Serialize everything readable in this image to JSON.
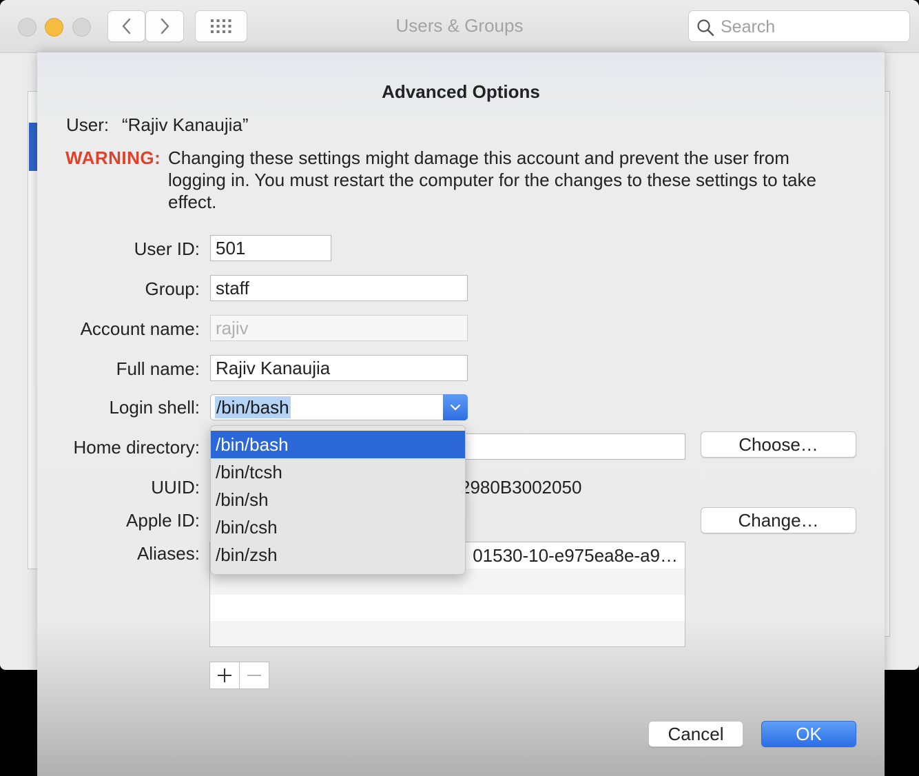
{
  "window": {
    "title": "Users & Groups",
    "search_placeholder": "Search"
  },
  "sheet": {
    "title": "Advanced Options",
    "user_label": "User:",
    "user_value": "“Rajiv Kanaujia”",
    "warning_label": "WARNING:",
    "warning_text": "Changing these settings might damage this account and prevent the user from logging in. You must restart the computer for the changes to these settings to take effect.",
    "fields": {
      "user_id": {
        "label": "User ID:",
        "value": "501"
      },
      "group": {
        "label": "Group:",
        "value": "staff"
      },
      "account_name": {
        "label": "Account name:",
        "value": "rajiv"
      },
      "full_name": {
        "label": "Full name:",
        "value": "Rajiv Kanaujia"
      },
      "login_shell": {
        "label": "Login shell:",
        "value": "/bin/bash"
      },
      "home_directory": {
        "label": "Home directory:",
        "value": ""
      },
      "uuid": {
        "label": "UUID:",
        "value_visible": "2980B3002050"
      },
      "apple_id": {
        "label": "Apple ID:"
      },
      "aliases": {
        "label": "Aliases:",
        "rows": [
          "01530-10-e975ea8e-a9…"
        ]
      }
    },
    "buttons": {
      "choose": "Choose…",
      "change": "Change…",
      "cancel": "Cancel",
      "ok": "OK",
      "add": "+",
      "remove": "−"
    },
    "shell_menu": {
      "options": [
        "/bin/bash",
        "/bin/tcsh",
        "/bin/sh",
        "/bin/csh",
        "/bin/zsh"
      ],
      "selected": "/bin/bash"
    }
  },
  "colors": {
    "accent": "#2c67d8",
    "warning": "#e0412a",
    "selection_highlight": "#b4d3f5"
  }
}
